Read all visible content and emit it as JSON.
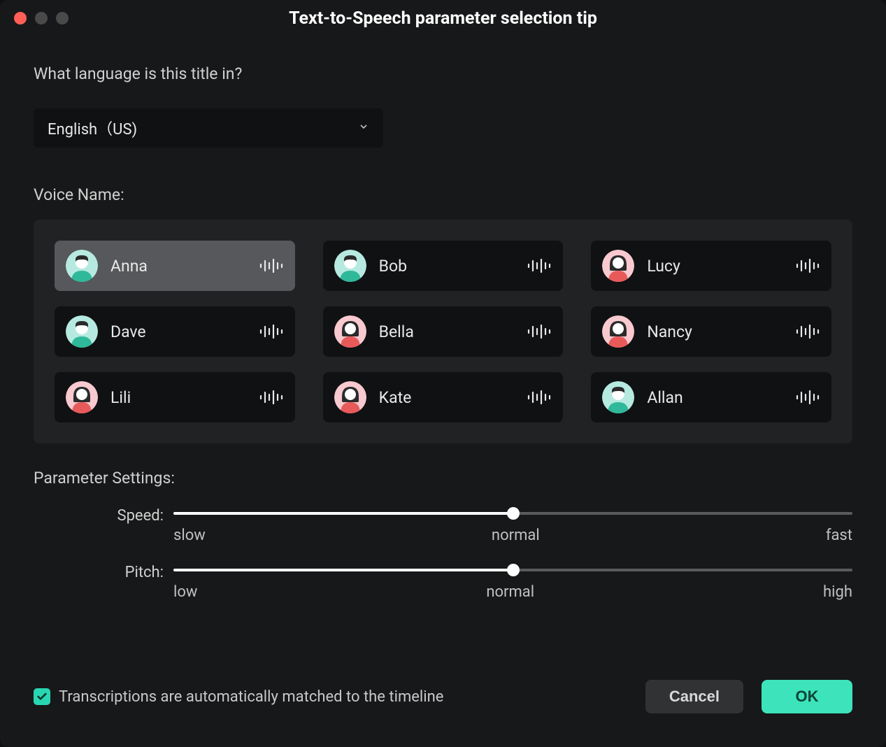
{
  "window": {
    "title": "Text-to-Speech parameter selection tip"
  },
  "language": {
    "question": "What language is this title in?",
    "selected": "English（US)"
  },
  "voice": {
    "label": "Voice Name:",
    "items": [
      {
        "name": "Anna",
        "avatar": "teal-male",
        "selected": true
      },
      {
        "name": "Bob",
        "avatar": "teal-male",
        "selected": false
      },
      {
        "name": "Lucy",
        "avatar": "pink-female",
        "selected": false
      },
      {
        "name": "Dave",
        "avatar": "teal-male",
        "selected": false
      },
      {
        "name": "Bella",
        "avatar": "pink-female",
        "selected": false
      },
      {
        "name": "Nancy",
        "avatar": "pink-female",
        "selected": false
      },
      {
        "name": "Lili",
        "avatar": "pink-female",
        "selected": false
      },
      {
        "name": "Kate",
        "avatar": "pink-female",
        "selected": false
      },
      {
        "name": "Allan",
        "avatar": "teal-male",
        "selected": false
      }
    ]
  },
  "parameters": {
    "label": "Parameter Settings:",
    "speed": {
      "name": "Speed:",
      "labels": {
        "min": "slow",
        "mid": "normal",
        "max": "fast"
      },
      "value_percent": 50
    },
    "pitch": {
      "name": "Pitch:",
      "labels": {
        "min": "low",
        "mid": "normal",
        "max": "high"
      },
      "value_percent": 50
    }
  },
  "footer": {
    "auto_match_label": "Transcriptions are automatically matched to the timeline",
    "auto_match_checked": true,
    "cancel": "Cancel",
    "ok": "OK"
  },
  "colors": {
    "accent": "#3de3bb",
    "bg": "#171819",
    "panel": "#202224",
    "card": "#101113",
    "card_selected": "#56585b"
  }
}
